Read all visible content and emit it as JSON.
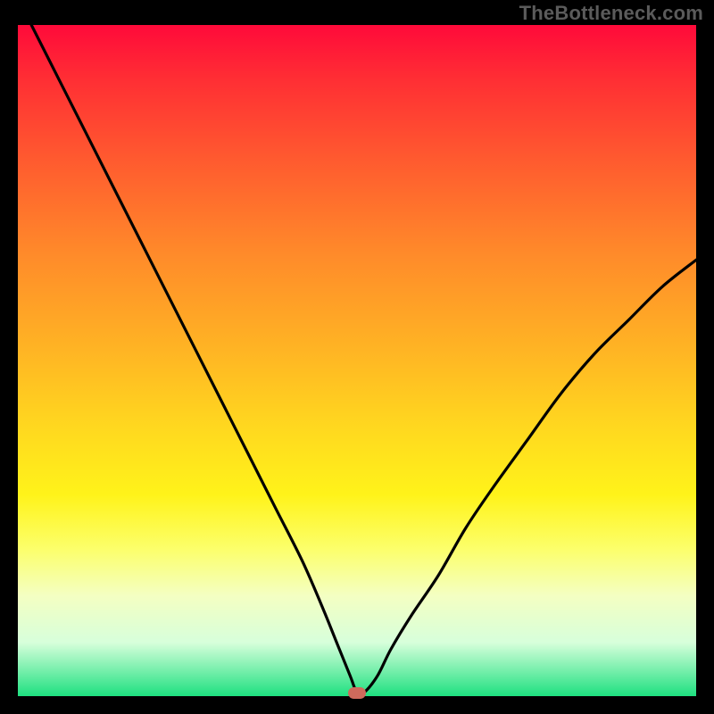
{
  "watermark": "TheBottleneck.com",
  "colors": {
    "frame": "#000000",
    "watermark_text": "#5b5b5b",
    "curve": "#000000",
    "marker": "#cf6a5c",
    "gradient_top": "#ff0a3a",
    "gradient_bottom": "#1ee080"
  },
  "chart_data": {
    "type": "line",
    "title": "",
    "xlabel": "",
    "ylabel": "",
    "xlim": [
      0,
      100
    ],
    "ylim": [
      0,
      100
    ],
    "grid": false,
    "legend": false,
    "series": [
      {
        "name": "bottleneck-curve",
        "x": [
          2,
          6,
          10,
          14,
          18,
          22,
          26,
          30,
          34,
          38,
          42,
          45,
          47,
          49,
          50,
          51,
          53,
          55,
          58,
          62,
          66,
          70,
          75,
          80,
          85,
          90,
          95,
          100
        ],
        "values": [
          100,
          92,
          84,
          76,
          68,
          60,
          52,
          44,
          36,
          28,
          20,
          13,
          8,
          3,
          0.5,
          0.5,
          3,
          7,
          12,
          18,
          25,
          31,
          38,
          45,
          51,
          56,
          61,
          65
        ]
      }
    ],
    "marker": {
      "x": 50,
      "y": 0.5
    },
    "background_gradient_stops": [
      {
        "pos": 0,
        "color": "#ff0a3a"
      },
      {
        "pos": 8,
        "color": "#ff2e34"
      },
      {
        "pos": 20,
        "color": "#ff5a2f"
      },
      {
        "pos": 34,
        "color": "#ff8a2a"
      },
      {
        "pos": 48,
        "color": "#ffb324"
      },
      {
        "pos": 60,
        "color": "#ffd81f"
      },
      {
        "pos": 70,
        "color": "#fff31a"
      },
      {
        "pos": 78,
        "color": "#fcff6a"
      },
      {
        "pos": 85,
        "color": "#f4ffc2"
      },
      {
        "pos": 92,
        "color": "#d7ffdb"
      },
      {
        "pos": 100,
        "color": "#1ee080"
      }
    ]
  }
}
